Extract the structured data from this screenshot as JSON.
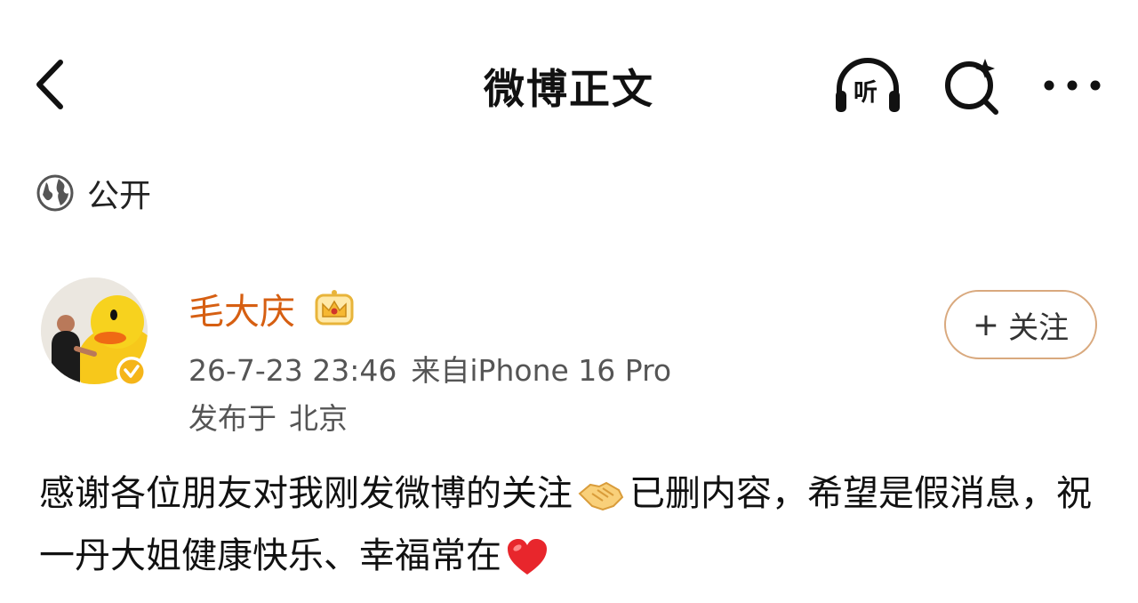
{
  "header": {
    "title": "微博正文",
    "listen_label": "听"
  },
  "visibility": {
    "label": "公开"
  },
  "author": {
    "name": "毛大庆",
    "time": "26-7-23 23:46",
    "device": "来自iPhone 16 Pro",
    "location_prefix": "发布于",
    "location": "北京",
    "follow_label": "关注",
    "follow_plus": "+"
  },
  "post": {
    "text_part1": "感谢各位朋友对我刚发微博的关注",
    "text_part2": "已删内容，希望是假消息，祝一丹大姐健康快乐、幸福常在"
  },
  "icons": {
    "back": "chevron-left-icon",
    "listen": "headphones-icon",
    "search": "search-icon",
    "more": "more-icon",
    "globe": "globe-icon",
    "crown": "crown-icon",
    "handshake": "handshake-icon",
    "heart": "heart-icon"
  },
  "colors": {
    "username": "#d65f12",
    "follow_border": "#d9a97e",
    "heart": "#e8262c"
  }
}
